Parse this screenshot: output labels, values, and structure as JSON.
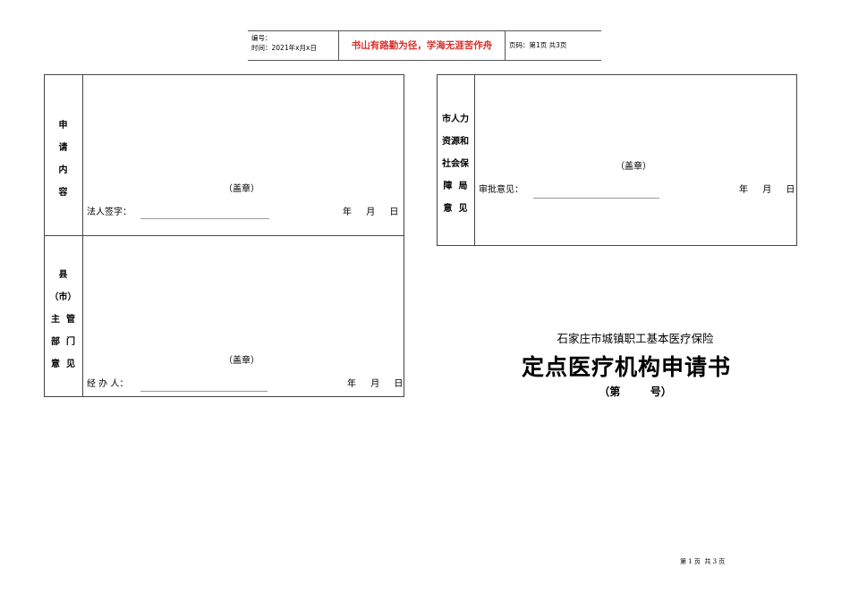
{
  "header": {
    "number_label": "编号：",
    "time_label": "时间：2021年x月x日",
    "motto": "书山有路勤为径，学海无涯苦作舟",
    "page_label": "页码：第1页  共3页"
  },
  "left_table": {
    "application": {
      "label_chars": [
        "申",
        "请",
        "内",
        "容"
      ],
      "seal": "（盖章）",
      "sign_label": "法人签字：",
      "date": [
        "年",
        "月",
        "日"
      ]
    },
    "county": {
      "label_lines": [
        "县",
        "（市）",
        "主  管",
        "部  门",
        "意  见"
      ],
      "seal": "（盖章）",
      "handler_label": "经 办 人：",
      "date": [
        "年",
        "月",
        "日"
      ]
    }
  },
  "right_table": {
    "label_lines": [
      "市人力",
      "资源和",
      "社会保",
      "障  局",
      "意  见"
    ],
    "seal": "（盖章）",
    "approval_label": "审批意见：",
    "date": [
      "年",
      "月",
      "日"
    ]
  },
  "cover": {
    "subtitle": "石家庄市城镇职工基本医疗保险",
    "title": "定点医疗机构申请书",
    "number_line": "（第        号）"
  },
  "footer": {
    "pager": "第 1 页  共 3 页"
  }
}
